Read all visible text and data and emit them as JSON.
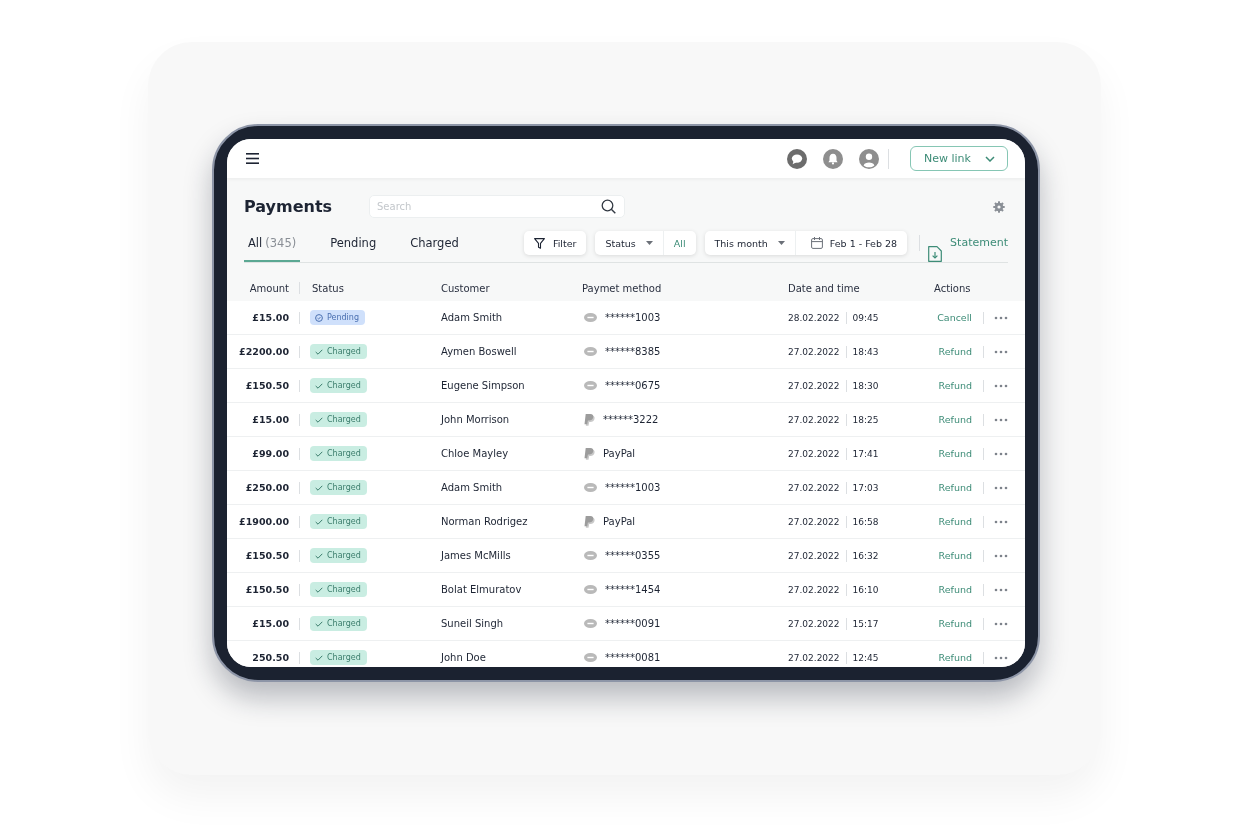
{
  "top_bar": {
    "new_link_button": {
      "label": "New link"
    }
  },
  "header": {
    "title": "Payments",
    "search": {
      "placeholder": "Search"
    }
  },
  "tabs": [
    {
      "label": "All",
      "count": "(345)",
      "selected": true
    },
    {
      "label": "Pending",
      "selected": false
    },
    {
      "label": "Charged",
      "selected": false
    }
  ],
  "filters": {
    "filter_button": {
      "label": "Filter"
    },
    "status": {
      "label": "Status",
      "value": "All"
    },
    "period": {
      "label": "This month",
      "range": "Feb 1 - Feb 28"
    },
    "statement_link": {
      "label": "Statement"
    }
  },
  "table": {
    "columns": [
      "Amount",
      "Status",
      "Customer",
      "Paymet method",
      "Date and time",
      "Actions"
    ],
    "rows": [
      {
        "amount": "£15.00",
        "status": {
          "kind": "pending",
          "label": "Pending"
        },
        "customer": "Adam Smith",
        "method": {
          "kind": "card",
          "text": "******1003"
        },
        "date": "28.02.2022",
        "time": "09:45",
        "action": "Cancell"
      },
      {
        "amount": "£2200.00",
        "status": {
          "kind": "charged",
          "label": "Charged"
        },
        "customer": "Aymen Boswell",
        "method": {
          "kind": "card",
          "text": "******8385"
        },
        "date": "27.02.2022",
        "time": "18:43",
        "action": "Refund"
      },
      {
        "amount": "£150.50",
        "status": {
          "kind": "charged",
          "label": "Charged"
        },
        "customer": "Eugene Simpson",
        "method": {
          "kind": "card",
          "text": "******0675"
        },
        "date": "27.02.2022",
        "time": "18:30",
        "action": "Refund"
      },
      {
        "amount": "£15.00",
        "status": {
          "kind": "charged",
          "label": "Charged"
        },
        "customer": "John Morrison",
        "method": {
          "kind": "paypal",
          "text": "******3222"
        },
        "date": "27.02.2022",
        "time": "18:25",
        "action": "Refund"
      },
      {
        "amount": "£99.00",
        "status": {
          "kind": "charged",
          "label": "Charged"
        },
        "customer": "Chloe Mayley",
        "method": {
          "kind": "paypal",
          "text": "PayPal"
        },
        "date": "27.02.2022",
        "time": "17:41",
        "action": "Refund"
      },
      {
        "amount": "£250.00",
        "status": {
          "kind": "charged",
          "label": "Charged"
        },
        "customer": "Adam Smith",
        "method": {
          "kind": "card",
          "text": "******1003"
        },
        "date": "27.02.2022",
        "time": "17:03",
        "action": "Refund"
      },
      {
        "amount": "£1900.00",
        "status": {
          "kind": "charged",
          "label": "Charged"
        },
        "customer": "Norman Rodrigez",
        "method": {
          "kind": "paypal",
          "text": "PayPal"
        },
        "date": "27.02.2022",
        "time": "16:58",
        "action": "Refund"
      },
      {
        "amount": "£150.50",
        "status": {
          "kind": "charged",
          "label": "Charged"
        },
        "customer": "James McMills",
        "method": {
          "kind": "card",
          "text": "******0355"
        },
        "date": "27.02.2022",
        "time": "16:32",
        "action": "Refund"
      },
      {
        "amount": "£150.50",
        "status": {
          "kind": "charged",
          "label": "Charged"
        },
        "customer": "Bolat Elmuratov",
        "method": {
          "kind": "card",
          "text": "******1454"
        },
        "date": "27.02.2022",
        "time": "16:10",
        "action": "Refund"
      },
      {
        "amount": "£15.00",
        "status": {
          "kind": "charged",
          "label": "Charged"
        },
        "customer": "Suneil Singh",
        "method": {
          "kind": "card",
          "text": "******0091"
        },
        "date": "27.02.2022",
        "time": "15:17",
        "action": "Refund"
      },
      {
        "amount": "250.50",
        "status": {
          "kind": "charged",
          "label": "Charged"
        },
        "customer": "John Doe",
        "method": {
          "kind": "card",
          "text": "******0081"
        },
        "date": "27.02.2022",
        "time": "12:45",
        "action": "Refund"
      }
    ]
  }
}
